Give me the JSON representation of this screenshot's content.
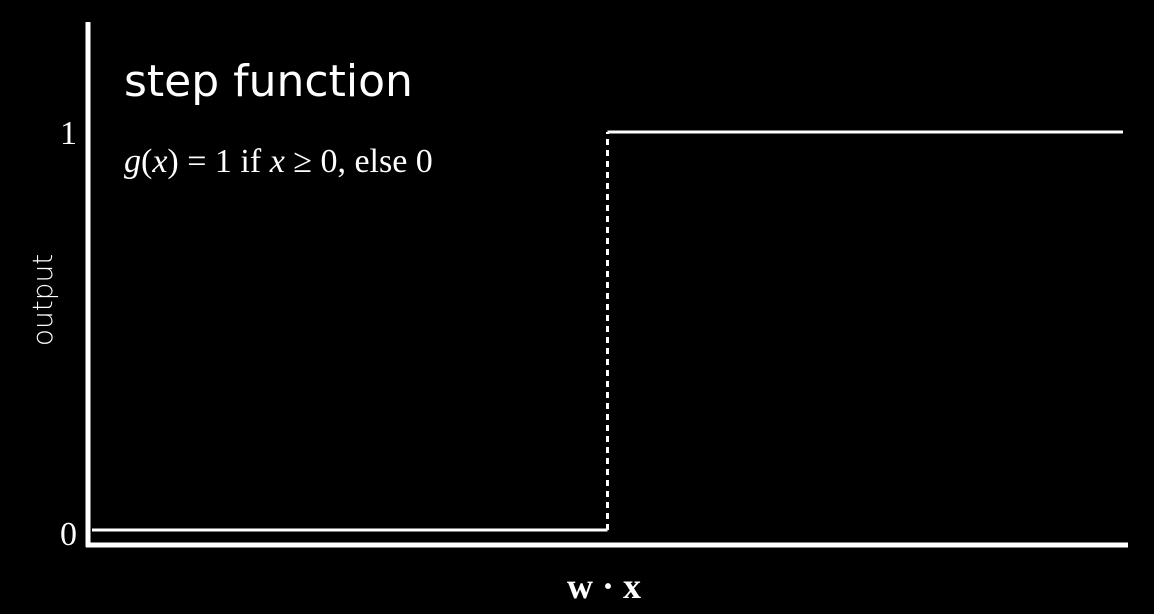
{
  "chart_data": {
    "type": "line",
    "title": "step function",
    "annotation": {
      "parts": [
        {
          "text": "g",
          "italic": true
        },
        {
          "text": "(",
          "italic": false
        },
        {
          "text": "x",
          "italic": true
        },
        {
          "text": ") = 1 if ",
          "italic": false
        },
        {
          "text": "x",
          "italic": true
        },
        {
          "text": " ≥ 0, else 0",
          "italic": false
        }
      ]
    },
    "xlabel": "w · x",
    "ylabel": "output",
    "y_ticks": [
      {
        "value": 0,
        "label": "0"
      },
      {
        "value": 1,
        "label": "1"
      }
    ],
    "xlim": [
      -1,
      1
    ],
    "ylim": [
      0,
      1
    ],
    "series": [
      {
        "points": [
          {
            "x": -1,
            "y": 0
          },
          {
            "x": 0,
            "y": 0
          },
          {
            "x": 0,
            "y": 1
          },
          {
            "x": 1,
            "y": 1
          }
        ]
      }
    ],
    "threshold_x": 0,
    "grid": false,
    "colors": {
      "background": "#000000",
      "foreground": "#ffffff"
    }
  }
}
